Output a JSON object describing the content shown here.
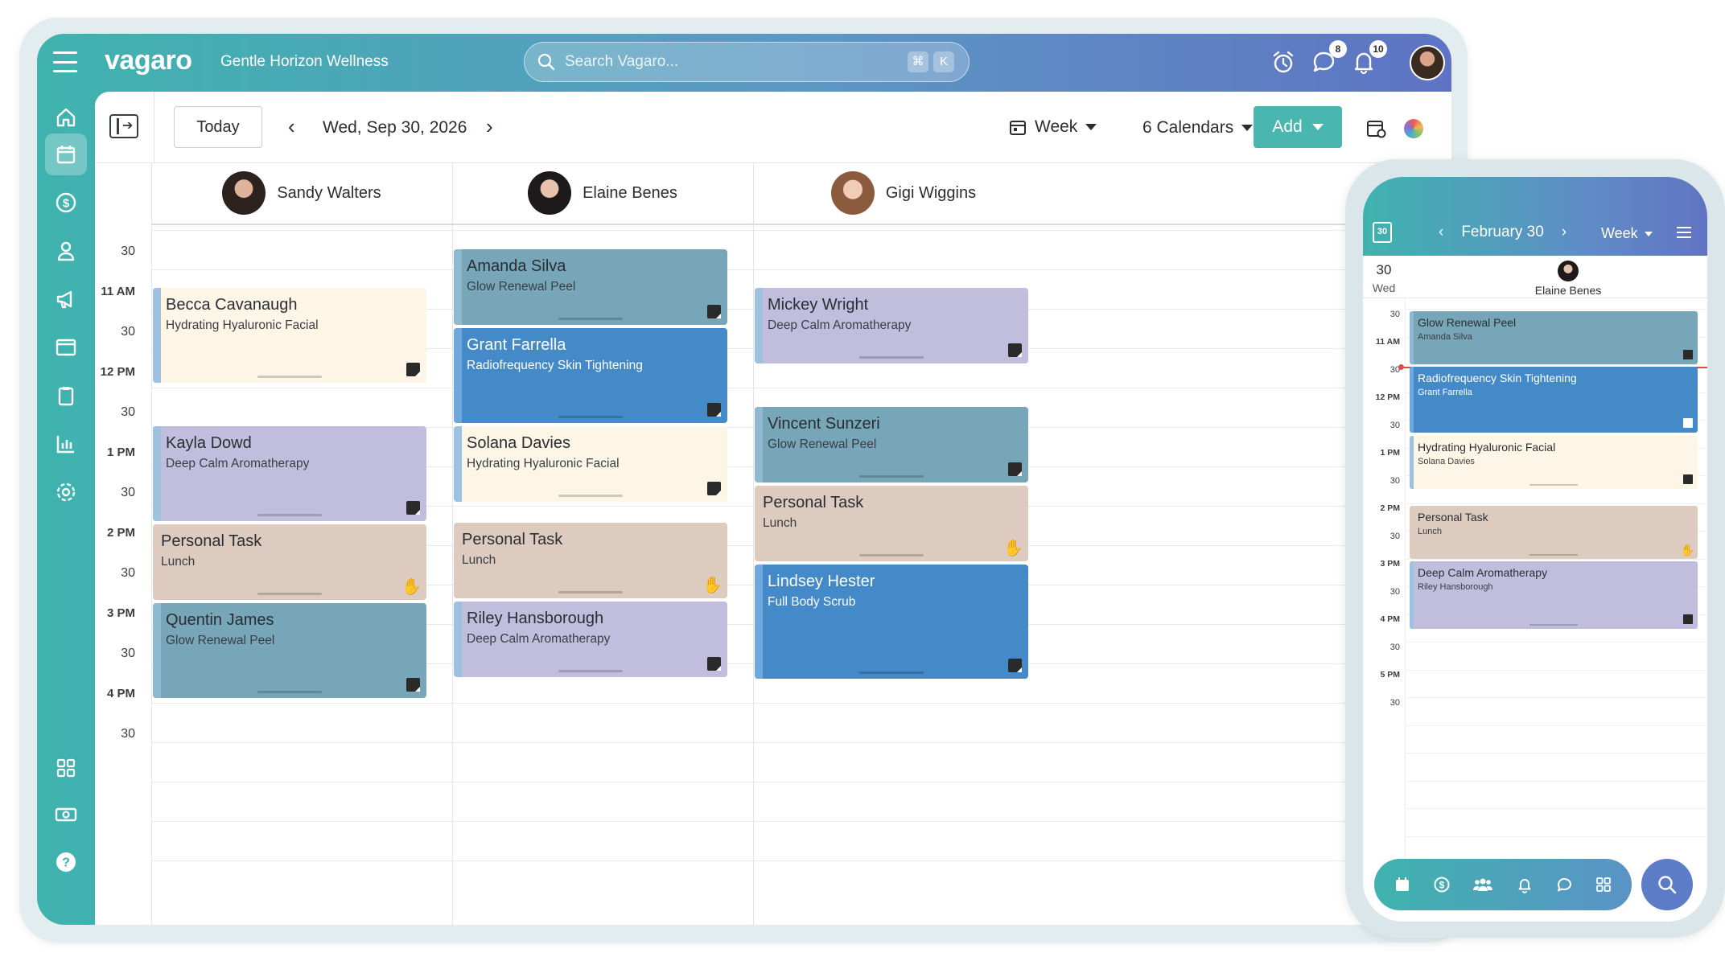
{
  "app": {
    "logo": "vagaro",
    "business": "Gentle Horizon Wellness"
  },
  "search": {
    "placeholder": "Search Vagaro...",
    "kbd1": "⌘",
    "kbd2": "K"
  },
  "topbar": {
    "messages_badge": "8",
    "notifications_badge": "10"
  },
  "sidenav": [
    "home-icon",
    "calendar-icon",
    "dollar-icon",
    "user-icon",
    "megaphone-icon",
    "browser-icon",
    "clipboard-icon",
    "chart-icon",
    "gear-icon",
    "apps-icon",
    "cash-icon",
    "help-icon"
  ],
  "toolbar": {
    "today": "Today",
    "date": "Wed, Sep 30, 2026",
    "view": "Week",
    "calendars": "6 Calendars",
    "add": "Add"
  },
  "staff": [
    {
      "name": "Sandy Walters"
    },
    {
      "name": "Elaine Benes"
    },
    {
      "name": "Gigi Wiggins"
    }
  ],
  "time_labels": [
    "30",
    "11 AM",
    "30",
    "12 PM",
    "30",
    "1 PM",
    "30",
    "2 PM",
    "30",
    "3 PM",
    "30",
    "4 PM",
    "30"
  ],
  "appointments": [
    {
      "staff": 0,
      "client": "Becca Cavanaugh",
      "service": "Hydrating Hyaluronic Facial",
      "color": "cream"
    },
    {
      "staff": 0,
      "client": "Kayla Dowd",
      "service": "Deep Calm Aromatherapy",
      "color": "lavender"
    },
    {
      "staff": 0,
      "client": "Personal Task",
      "service": "Lunch",
      "color": "tan"
    },
    {
      "staff": 0,
      "client": "Quentin James",
      "service": "Glow Renewal Peel",
      "color": "peel"
    },
    {
      "staff": 1,
      "client": "Amanda Silva",
      "service": "Glow Renewal Peel",
      "color": "peel"
    },
    {
      "staff": 1,
      "client": "Grant Farrella",
      "service": "Radiofrequency Skin Tightening",
      "color": "blue"
    },
    {
      "staff": 1,
      "client": "Solana Davies",
      "service": "Hydrating Hyaluronic Facial",
      "color": "cream"
    },
    {
      "staff": 1,
      "client": "Personal Task",
      "service": "Lunch",
      "color": "tan"
    },
    {
      "staff": 1,
      "client": "Riley Hansborough",
      "service": "Deep Calm Aromatherapy",
      "color": "lavender"
    },
    {
      "staff": 2,
      "client": "Mickey Wright",
      "service": "Deep Calm Aromatherapy",
      "color": "lavender"
    },
    {
      "staff": 2,
      "client": "Vincent Sunzeri",
      "service": "Glow Renewal Peel",
      "color": "peel"
    },
    {
      "staff": 2,
      "client": "Personal Task",
      "service": "Lunch",
      "color": "tan"
    },
    {
      "staff": 2,
      "client": "Lindsey Hester",
      "service": "Full Body Scrub",
      "color": "blue"
    }
  ],
  "phone": {
    "title": "February 30",
    "view": "Week",
    "cal_icon_num": "30",
    "day_num": "30",
    "day_name": "Wed",
    "staff": "Elaine Benes",
    "time_labels": [
      "30",
      "11 AM",
      "30",
      "12 PM",
      "30",
      "1 PM",
      "30",
      "2 PM",
      "30",
      "3 PM",
      "30",
      "4 PM",
      "30",
      "5 PM",
      "30"
    ],
    "appointments": [
      {
        "service": "Glow Renewal Peel",
        "client": "Amanda Silva",
        "color": "peel"
      },
      {
        "service": "Radiofrequency Skin Tightening",
        "client": "Grant Farrella",
        "color": "blue"
      },
      {
        "service": "Hydrating Hyaluronic Facial",
        "client": "Solana Davies",
        "color": "cream"
      },
      {
        "service": "Personal Task",
        "client": "Lunch",
        "color": "tan"
      },
      {
        "service": "Deep Calm Aromatherapy",
        "client": "Riley Hansborough",
        "color": "lavender"
      }
    ]
  },
  "colors": {
    "accent": "#4ab6b0",
    "peel": "#76a6b7",
    "blue": "#4489c8",
    "cream": "#fdf6e7",
    "lavender": "#c1bedd",
    "tan": "#dccbbe"
  }
}
